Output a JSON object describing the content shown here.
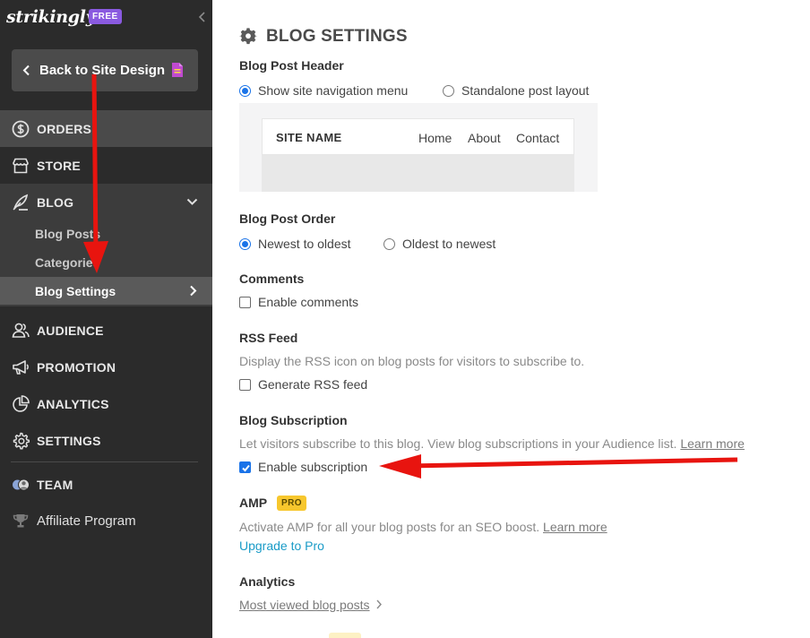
{
  "sidebar": {
    "logo": "strikingly",
    "free_badge": "FREE",
    "back_label": "Back to Site Design",
    "nav": {
      "orders": "ORDERS",
      "store": "STORE",
      "blog": "BLOG",
      "audience": "AUDIENCE",
      "promotion": "PROMOTION",
      "analytics": "ANALYTICS",
      "settings": "SETTINGS",
      "team": "TEAM",
      "affiliate": "Affiliate Program"
    },
    "blog_sub": {
      "posts": "Blog Posts",
      "categories": "Categories",
      "settings": "Blog Settings"
    }
  },
  "main": {
    "title": "BLOG SETTINGS",
    "header": {
      "heading": "Blog Post Header",
      "opt_nav": "Show site navigation menu",
      "opt_standalone": "Standalone post layout",
      "preview_site": "SITE NAME",
      "preview_home": "Home",
      "preview_about": "About",
      "preview_contact": "Contact"
    },
    "order": {
      "heading": "Blog Post Order",
      "opt_newest": "Newest to oldest",
      "opt_oldest": "Oldest to newest"
    },
    "comments": {
      "heading": "Comments",
      "opt": "Enable comments"
    },
    "rss": {
      "heading": "RSS Feed",
      "desc": "Display the RSS icon on blog posts for visitors to subscribe to.",
      "opt": "Generate RSS feed"
    },
    "subscription": {
      "heading": "Blog Subscription",
      "desc": "Let visitors subscribe to this blog. View blog subscriptions in your Audience list.",
      "learn_more": "Learn more",
      "opt": "Enable subscription"
    },
    "amp": {
      "heading": "AMP",
      "badge": "PRO",
      "desc": "Activate AMP for all your blog posts for an SEO boost.",
      "learn_more": "Learn more",
      "upgrade": "Upgrade to Pro"
    },
    "analytics": {
      "heading": "Analytics",
      "link": "Most viewed blog posts"
    }
  },
  "colors": {
    "sidebar_bg": "#2b2b2b",
    "accent_blue": "#1a73e8",
    "link_blue": "#1a9bc7",
    "pro_yellow": "#f7c72d",
    "free_purple": "#8a5ae0",
    "arrow_red": "#e8140f"
  }
}
